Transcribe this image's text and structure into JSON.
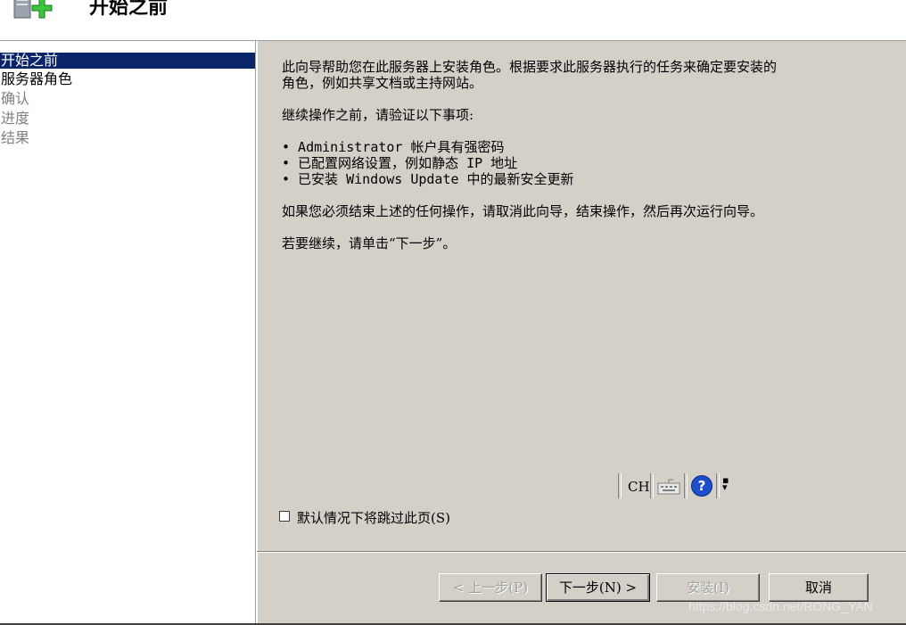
{
  "header": {
    "title": "开始之前",
    "icon": "server-add-icon"
  },
  "nav": {
    "items": [
      {
        "label": "开始之前",
        "state": "active"
      },
      {
        "label": "服务器角色",
        "state": "enabled"
      },
      {
        "label": "确认",
        "state": "disabled"
      },
      {
        "label": "进度",
        "state": "disabled"
      },
      {
        "label": "结果",
        "state": "disabled"
      }
    ]
  },
  "content": {
    "intro_line1": "此向导帮助您在此服务器上安装角色。根据要求此服务器执行的任务来确定要安装的",
    "intro_line2": "角色，例如共享文档或主持网站。",
    "verify": "继续操作之前，请验证以下事项:",
    "bullets": [
      "• Administrator 帐户具有强密码",
      "• 已配置网络设置，例如静态 IP 地址",
      "• 已安装 Windows Update 中的最新安全更新"
    ],
    "cancel_note": "如果您必须结束上述的任何操作，请取消此向导，结束操作，然后再次运行向导。",
    "continue_note": "若要继续，请单击“下一步”。"
  },
  "langbar": {
    "language": "CH",
    "keyboard_icon": "keyboard-icon",
    "help_icon": "help-icon",
    "help_glyph": "?",
    "options_icon": "options-icon"
  },
  "skip_checkbox": {
    "label": "默认情况下将跳过此页(S)",
    "checked": false
  },
  "buttons": {
    "back": "< 上一步(P)",
    "next": "下一步(N) >",
    "install": "安装(I)",
    "cancel": "取消"
  },
  "watermark": "https://blog.csdn.net/RONG_YAN"
}
